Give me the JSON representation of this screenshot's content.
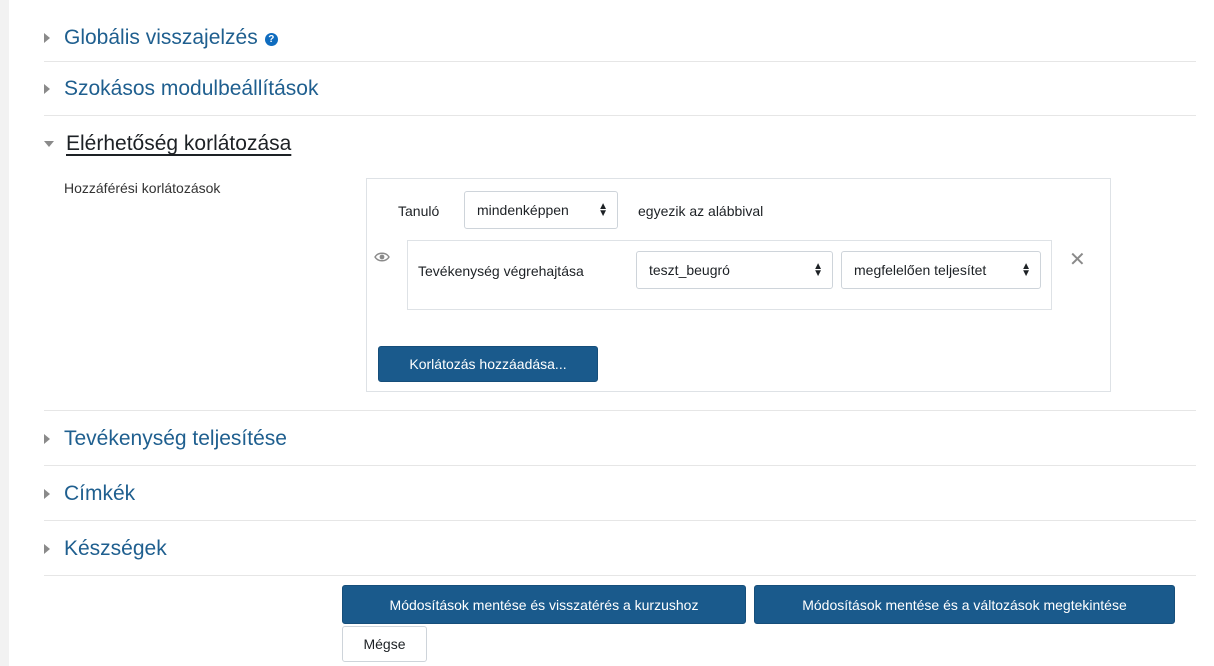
{
  "sections": [
    {
      "label": "Globális visszajelzés",
      "expanded": false,
      "has_help_icon": true
    },
    {
      "label": "Szokásos modulbeállítások",
      "expanded": false
    },
    {
      "label": "Elérhetőség korlátozása",
      "expanded": true
    },
    {
      "label": "Tevékenység teljesítése",
      "expanded": false
    },
    {
      "label": "Címkék",
      "expanded": false
    },
    {
      "label": "Készségek",
      "expanded": false
    }
  ],
  "restrict": {
    "field_label": "Hozzáférési korlátozások",
    "student_label": "Tanuló",
    "must_select": "mindenképpen",
    "match_text": "egyezik az alábbival",
    "condition": {
      "type_label": "Tevékenység végrehajtása",
      "activity_select": "teszt_beugró",
      "state_select": "megfelelően teljesítet"
    },
    "add_button": "Korlátozás hozzáadása..."
  },
  "footer": {
    "save_return": "Módosítások mentése és visszatérés a kurzushoz",
    "save_display": "Módosítások mentése és a változások megtekintése",
    "cancel": "Mégse"
  },
  "colors": {
    "primary": "#1a5a8c",
    "link": "#1f5f8f",
    "help_icon": "#0f6cbf"
  }
}
